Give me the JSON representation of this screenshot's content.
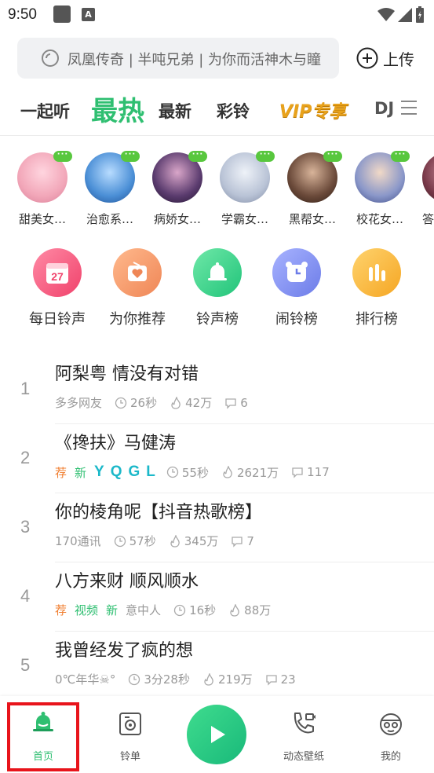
{
  "status": {
    "time": "9:50"
  },
  "search": {
    "placeholder": "凤凰传奇 | 半吨兄弟 | 为你而活神木与瞳",
    "upload_label": "上传"
  },
  "tabs": [
    {
      "label": "一起听"
    },
    {
      "label": "最热",
      "active": true
    },
    {
      "label": "最新"
    },
    {
      "label": "彩铃"
    },
    {
      "label": "VIP专享"
    },
    {
      "label": "DJ"
    }
  ],
  "avatars": [
    {
      "label": "甜美女…",
      "color": "#f2a7b9"
    },
    {
      "label": "治愈系…",
      "color": "#4b8fd6"
    },
    {
      "label": "病娇女…",
      "color": "#5a3b6e"
    },
    {
      "label": "学霸女…",
      "color": "#b9c3d6"
    },
    {
      "label": "黑帮女…",
      "color": "#6b4a3a"
    },
    {
      "label": "校花女…",
      "color": "#8a97c9"
    },
    {
      "label": "答",
      "color": "#7a3a4a"
    }
  ],
  "tiles": [
    {
      "label": "每日铃声",
      "icon": "calendar-icon",
      "color": "#f45a7d",
      "number": "27"
    },
    {
      "label": "为你推荐",
      "icon": "heart-radio-icon",
      "color": "#f39a6b"
    },
    {
      "label": "铃声榜",
      "icon": "bell-icon",
      "color": "#3fd487"
    },
    {
      "label": "闹铃榜",
      "icon": "alarm-clock-icon",
      "color": "#7f8ef2"
    },
    {
      "label": "排行榜",
      "icon": "bar-chart-icon",
      "color": "#f7b53a"
    }
  ],
  "songs": [
    {
      "num": "1",
      "title": "阿梨粤 情没有对错",
      "author": "多多网友",
      "duration": "26秒",
      "plays": "42万",
      "comments": "6"
    },
    {
      "num": "2",
      "title": "《搀扶》马健涛",
      "tag1": "荐",
      "tag2": "新",
      "yqgl": "YQGL",
      "duration": "55秒",
      "plays": "2621万",
      "comments": "117"
    },
    {
      "num": "3",
      "title": "你的棱角呢【抖音热歌榜】",
      "author": "170通讯",
      "duration": "57秒",
      "plays": "345万",
      "comments": "7"
    },
    {
      "num": "4",
      "title": "八方来财 顺风顺水",
      "tag1": "荐",
      "tag2": "视频",
      "tag3": "新",
      "author": "意中人",
      "duration": "16秒",
      "plays": "88万"
    },
    {
      "num": "5",
      "title": "我曾经发了疯的想",
      "author": "0℃年华☠°",
      "duration": "3分28秒",
      "plays": "219万",
      "comments": "23"
    }
  ],
  "nav": [
    {
      "label": "首页",
      "active": true
    },
    {
      "label": "铃单"
    },
    {
      "label": "动态壁纸"
    },
    {
      "label": "我的"
    }
  ],
  "colors": {
    "accent": "#2fbf71",
    "highlight": "#e8141b"
  }
}
